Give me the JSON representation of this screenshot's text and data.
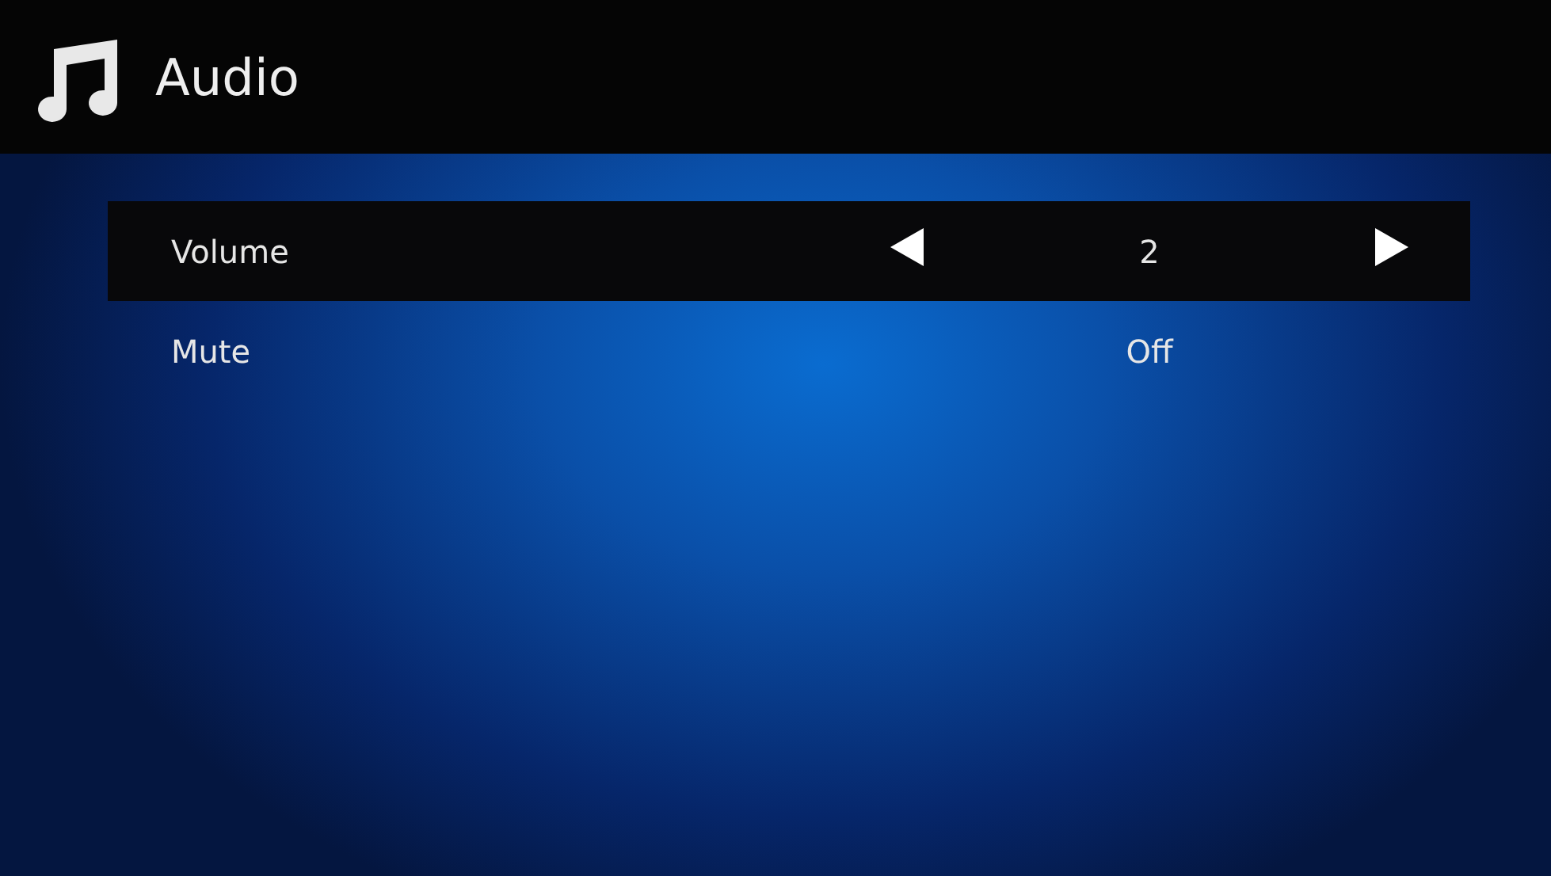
{
  "header": {
    "title": "Audio"
  },
  "settings": [
    {
      "label": "Volume",
      "value": "2",
      "selected": true
    },
    {
      "label": "Mute",
      "value": "Off",
      "selected": false
    }
  ]
}
